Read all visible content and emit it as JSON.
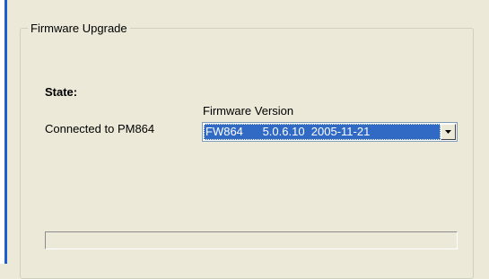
{
  "group": {
    "title": "Firmware Upgrade"
  },
  "state": {
    "label": "State:",
    "status": "Connected to PM864"
  },
  "firmware": {
    "label": "Firmware Version",
    "selected": "FW864      5.0.6.10  2005-11-21"
  },
  "progress": {
    "fraction": 0
  },
  "colors": {
    "background": "#ece9d8",
    "selection": "#316ac5",
    "left_accent": "#1b5fd0"
  }
}
